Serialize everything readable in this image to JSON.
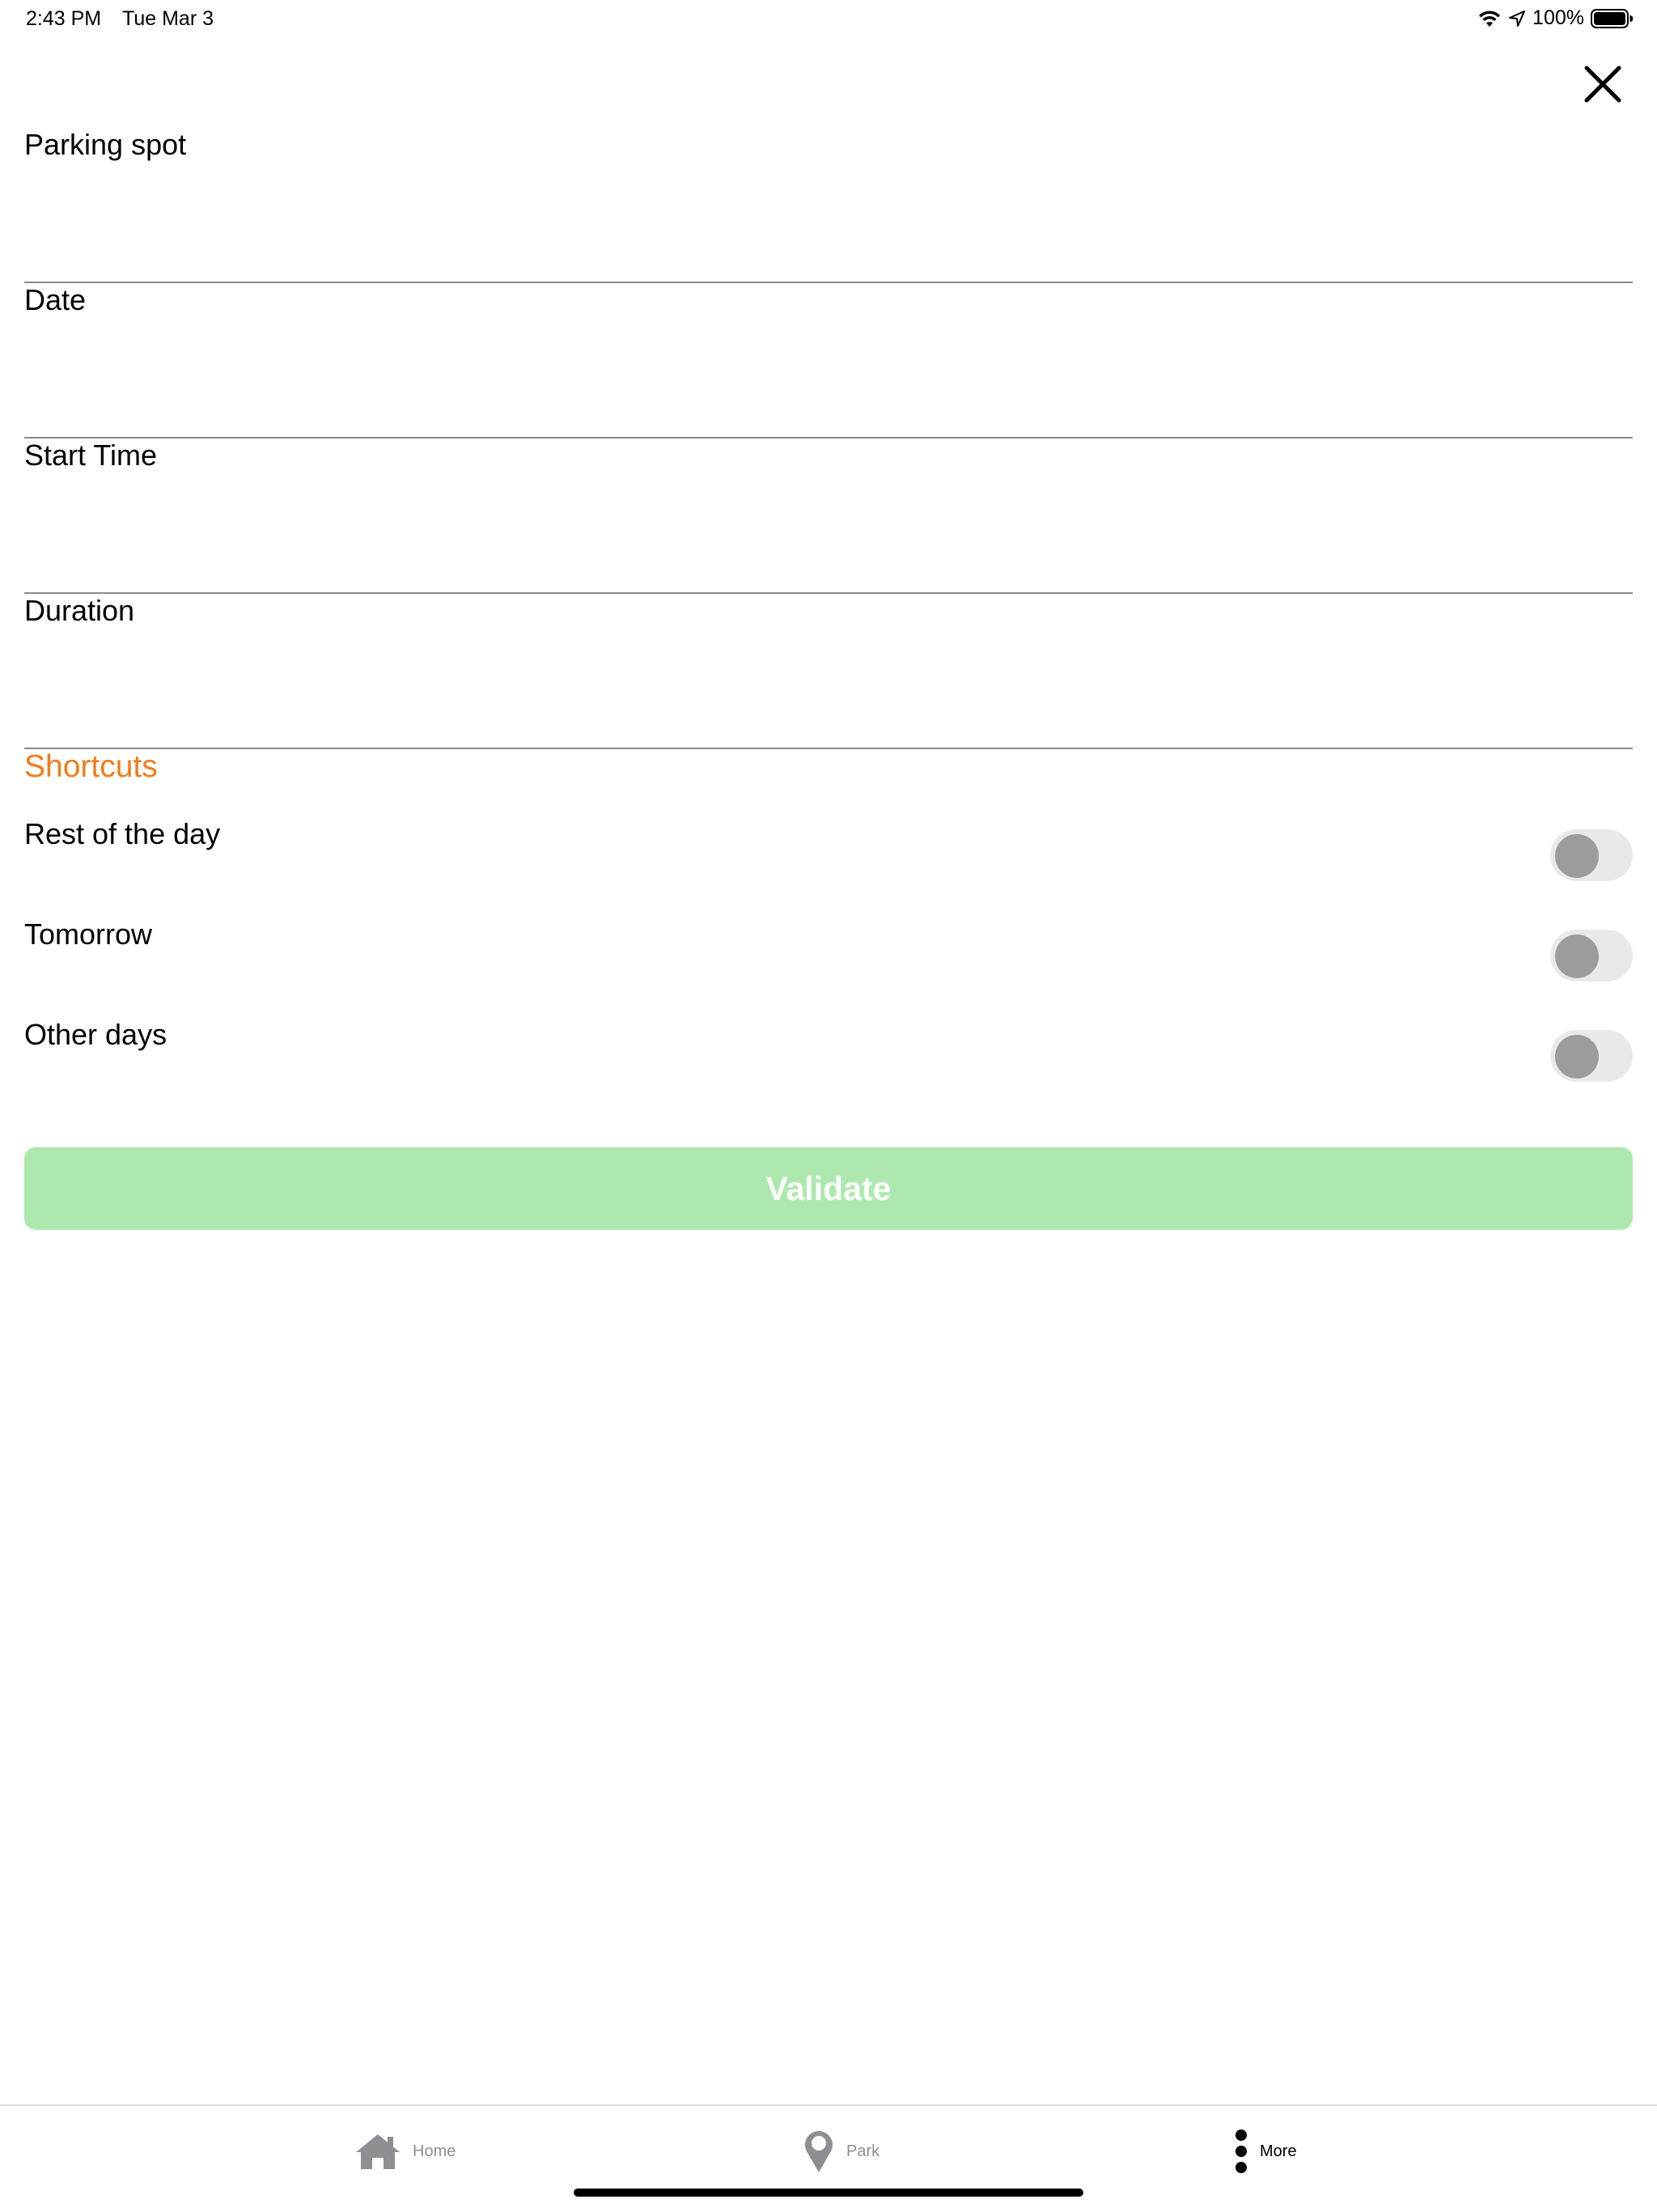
{
  "status_bar": {
    "time": "2:43 PM",
    "date": "Tue Mar 3",
    "battery": "100%"
  },
  "form": {
    "fields": [
      {
        "label": "Parking spot",
        "value": ""
      },
      {
        "label": "Date",
        "value": ""
      },
      {
        "label": "Start Time",
        "value": ""
      },
      {
        "label": "Duration",
        "value": ""
      }
    ],
    "shortcuts_title": "Shortcuts",
    "shortcuts": [
      {
        "label": "Rest of the day",
        "on": false
      },
      {
        "label": "Tomorrow",
        "on": false
      },
      {
        "label": "Other days",
        "on": false
      }
    ],
    "validate_label": "Validate"
  },
  "tab_bar": {
    "tabs": [
      {
        "label": "Home",
        "icon": "home-icon",
        "active": false
      },
      {
        "label": "Park",
        "icon": "map-pin-icon",
        "active": false
      },
      {
        "label": "More",
        "icon": "more-vertical-icon",
        "active": true
      }
    ]
  },
  "colors": {
    "accent": "#f07d1a",
    "validate_bg": "#ade9ae",
    "divider": "#8a8a8a"
  }
}
